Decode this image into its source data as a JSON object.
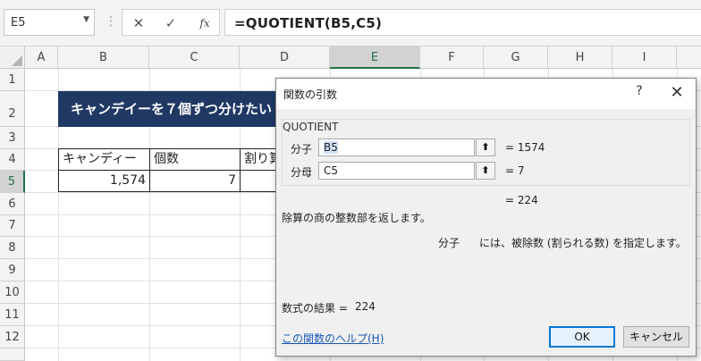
{
  "formula_bar": {
    "name_box": "E5",
    "formula": "=QUOTIENT(B5,C5)",
    "icons": {
      "cancel": "cancel-icon",
      "enter": "check-icon",
      "fx": "fx-icon"
    }
  },
  "columns": [
    "A",
    "B",
    "C",
    "D",
    "E",
    "F",
    "G",
    "H",
    "I"
  ],
  "rows": [
    "1",
    "2",
    "3",
    "4",
    "5",
    "6",
    "7",
    "8",
    "9",
    "10",
    "11",
    "12"
  ],
  "sheet": {
    "title": "キャンデイーを７個ずつ分けたい",
    "headers": [
      "キャンディー",
      "個数",
      "割り算"
    ],
    "values": [
      "1,574",
      "7"
    ]
  },
  "dialog": {
    "title": "関数の引数",
    "help_glyph": "?",
    "close_glyph": "✕",
    "function_name": "QUOTIENT",
    "args": [
      {
        "label": "分子",
        "value": "B5",
        "result": "=  1574"
      },
      {
        "label": "分母",
        "value": "C5",
        "result": "=  7"
      }
    ],
    "formula_result": "=  224",
    "description": "除算の商の整数部を返します。",
    "arg_help_name": "分子",
    "arg_help_text": "には、被除数 (割られる数) を指定します。",
    "result_label": "数式の結果 =",
    "result_value": "224",
    "help_link": "この関数のヘルプ(H)",
    "ok": "OK",
    "cancel": "キャンセル"
  },
  "colors": {
    "title_fill": "#1f3864",
    "selection": "#217346",
    "ok_border": "#0078d7",
    "link": "#1a56b8"
  }
}
